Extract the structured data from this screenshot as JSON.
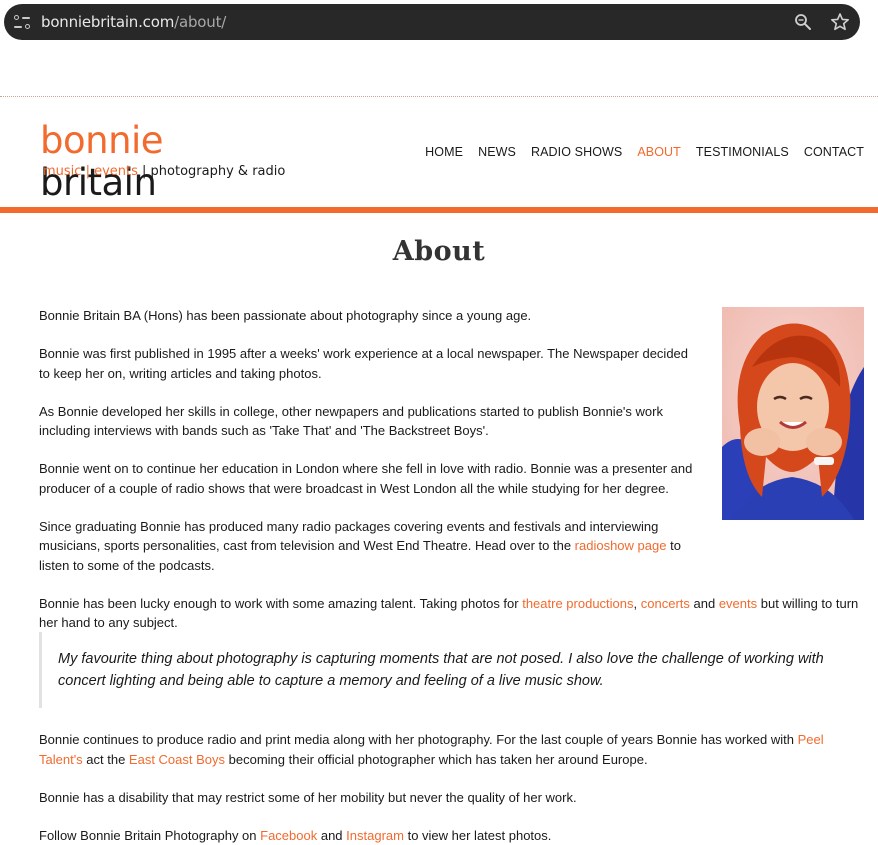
{
  "browser": {
    "url_host": "bonniebritain.com",
    "url_path": "/about/"
  },
  "logo": {
    "word1": "bonnie",
    "word2": "britain",
    "sub_music": "music",
    "sub_sep1": " | ",
    "sub_events": "events",
    "sub_rest": " | photography & radio"
  },
  "nav": {
    "items": [
      {
        "label": "HOME"
      },
      {
        "label": "NEWS"
      },
      {
        "label": "RADIO SHOWS"
      },
      {
        "label": "ABOUT"
      },
      {
        "label": "TESTIMONIALS"
      },
      {
        "label": "CONTACT"
      }
    ],
    "active_color": "#f26a2e"
  },
  "page": {
    "title": "About",
    "p1": "Bonnie Britain BA (Hons) has been passionate about photography since a young age.",
    "p2": "Bonnie was first published in 1995 after a weeks' work experience at a local newspaper. The Newspaper decided to keep her on, writing articles and taking photos.",
    "p3": "As Bonnie developed her skills in college, other newpapers and publications started to publish Bonnie's work including interviews with bands such as 'Take That' and 'The Backstreet Boys'.",
    "p4": "Bonnie went on to continue her education in London where she fell in love with radio. Bonnie was a presenter and producer of a couple of radio shows that were broadcast in West London all the while studying for her degree.",
    "p5_a": "Since graduating Bonnie has produced many radio packages covering events and festivals and interviewing musicians, sports personalities, cast from television and West End Theatre. Head over to the ",
    "p5_link": "radioshow page",
    "p5_b": " to listen to some of the podcasts.",
    "p6_a": "Bonnie has been lucky enough to work with some amazing talent. Taking photos for ",
    "p6_link1": "theatre productions",
    "p6_sep": ", ",
    "p6_link2": "concerts",
    "p6_and": " and ",
    "p6_link3": "events",
    "p6_b": " but willing to turn her hand to any subject.",
    "quote": "My favourite thing about photography is capturing moments that are not posed. I also love the challenge of working with concert lighting and being able to capture a memory and feeling of a live music show.",
    "p7_a": "Bonnie continues to produce radio and print media along with her photography. For the last couple of years Bonnie has worked with ",
    "p7_link1": "Peel Talent's",
    "p7_b": " act the ",
    "p7_link2": "East Coast Boys",
    "p7_c": " becoming their official photographer which has taken her around Europe.",
    "p8": "Bonnie has a disability that may restrict some of her mobility but never the quality of her work.",
    "p9_a": "Follow Bonnie Britain Photography on ",
    "p9_link1": "Facebook",
    "p9_and": " and ",
    "p9_link2": "Instagram",
    "p9_b": " to view her latest photos."
  },
  "colors": {
    "accent": "#f26a2e",
    "text": "#1a1a1a"
  }
}
